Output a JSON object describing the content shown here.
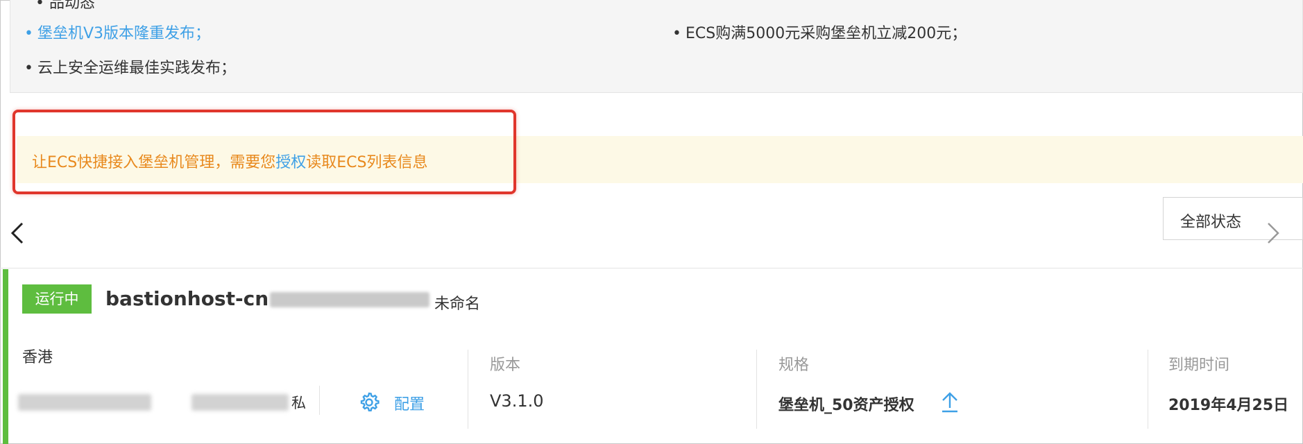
{
  "news": {
    "partial_header": "• 品动态",
    "items": [
      {
        "text": "堡垒机V3版本隆重发布；",
        "link": true
      },
      {
        "text": "ECS购满5000元采购堡垒机立减200元；",
        "link": false
      },
      {
        "text": "云上安全运维最佳实践发布；",
        "link": false
      }
    ]
  },
  "notice": {
    "prefix": "让ECS快捷接入堡垒机管理，需要您",
    "link": "授权",
    "suffix": "读取ECS列表信息"
  },
  "filter": {
    "label": "全部状态"
  },
  "icons": {
    "prev": "chevron-left-icon",
    "next": "chevron-right-icon",
    "config": "gear-icon",
    "upgrade": "upgrade-arrow-icon"
  },
  "colors": {
    "accent": "#3ea0e6",
    "running": "#5ebd3f",
    "warning": "#e8891d",
    "highlight": "#e0362c"
  },
  "instance": {
    "status": "运行中",
    "id_prefix": "bastionhost-cn",
    "name": "未命名",
    "region": "香港",
    "ip_suffix": "私",
    "config_label": "配置",
    "version_label": "版本",
    "version_value": "V3.1.0",
    "spec_label": "规格",
    "spec_value": "堡垒机_50资产授权",
    "expiry_label": "到期时间",
    "expiry_value": "2019年4月25日"
  }
}
